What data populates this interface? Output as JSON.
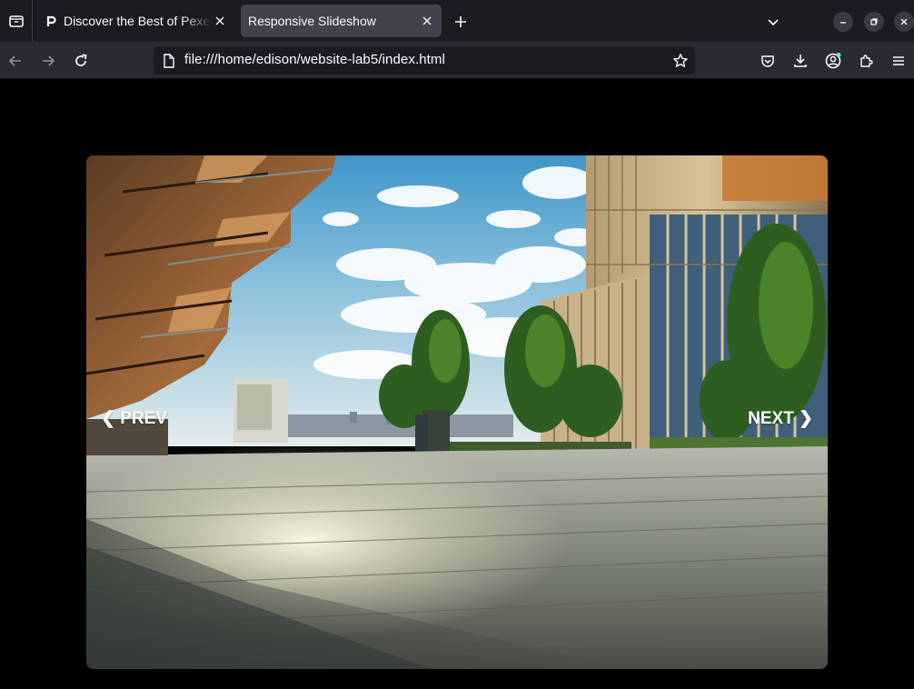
{
  "browser": {
    "tabs": [
      {
        "title": "Discover the Best of Pexels",
        "icon": "pexels-logo-icon",
        "active": false
      },
      {
        "title": "Responsive Slideshow",
        "active": true
      }
    ],
    "url": "file:///home/edison/website-lab5/index.html",
    "colors": {
      "tabbar": "#1c1b22",
      "navbar": "#2b2a33",
      "active_tab": "#42414d",
      "urlbar": "#1c1b22"
    },
    "toolbar_icons": [
      "back-icon",
      "forward-icon",
      "reload-icon",
      "bookmark-star-icon",
      "pocket-icon",
      "downloads-icon",
      "account-icon",
      "extensions-icon",
      "menu-icon"
    ]
  },
  "slideshow": {
    "prev_label": "❮ PREV",
    "next_label": "NEXT ❯"
  }
}
